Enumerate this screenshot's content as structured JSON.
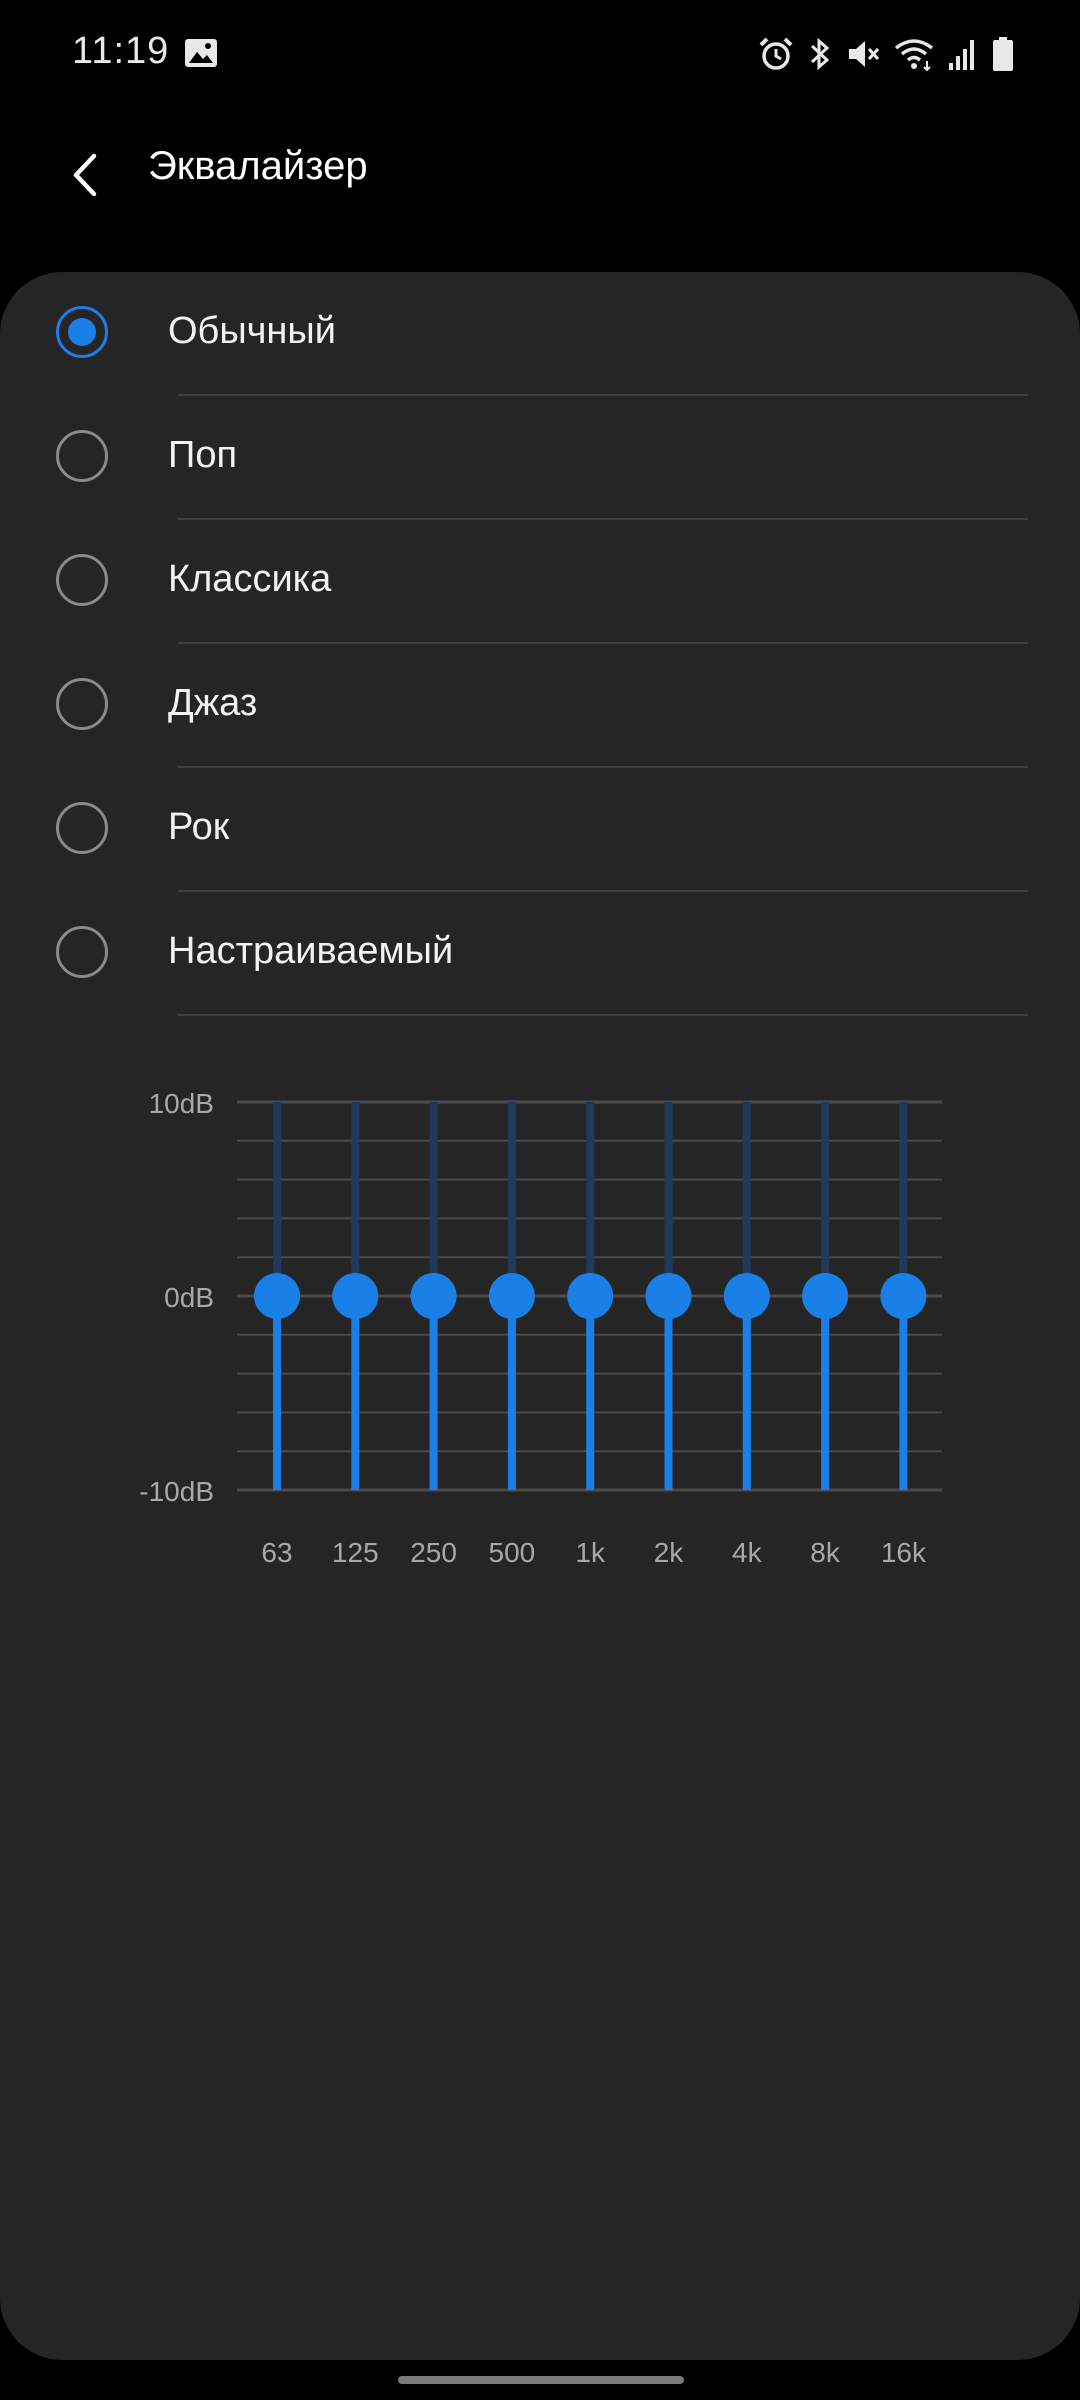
{
  "status_bar": {
    "time": "11:19",
    "icons": [
      "gallery-icon",
      "alarm-icon",
      "bluetooth-icon",
      "mute-icon",
      "wifi-icon",
      "signal-icon",
      "battery-icon"
    ]
  },
  "app_bar": {
    "title": "Эквалайзер",
    "back_icon": "chevron-left-icon"
  },
  "presets": [
    {
      "label": "Обычный",
      "selected": true
    },
    {
      "label": "Поп",
      "selected": false
    },
    {
      "label": "Классика",
      "selected": false
    },
    {
      "label": "Джаз",
      "selected": false
    },
    {
      "label": "Рок",
      "selected": false
    },
    {
      "label": "Настраиваемый",
      "selected": false
    }
  ],
  "colors": {
    "background": "#000000",
    "card": "#252525",
    "accent": "#1a80e8",
    "track_upper": "#203a5c",
    "grid": "#4a4a4a",
    "label": "#a8a8a8"
  },
  "chart_data": {
    "type": "bar",
    "y_tick_labels": [
      "10dB",
      "0dB",
      "-10dB"
    ],
    "ylim": [
      -10,
      10
    ],
    "grid": true,
    "categories": [
      "63",
      "125",
      "250",
      "500",
      "1k",
      "2k",
      "4k",
      "8k",
      "16k"
    ],
    "values": [
      0,
      0,
      0,
      0,
      0,
      0,
      0,
      0,
      0
    ]
  }
}
